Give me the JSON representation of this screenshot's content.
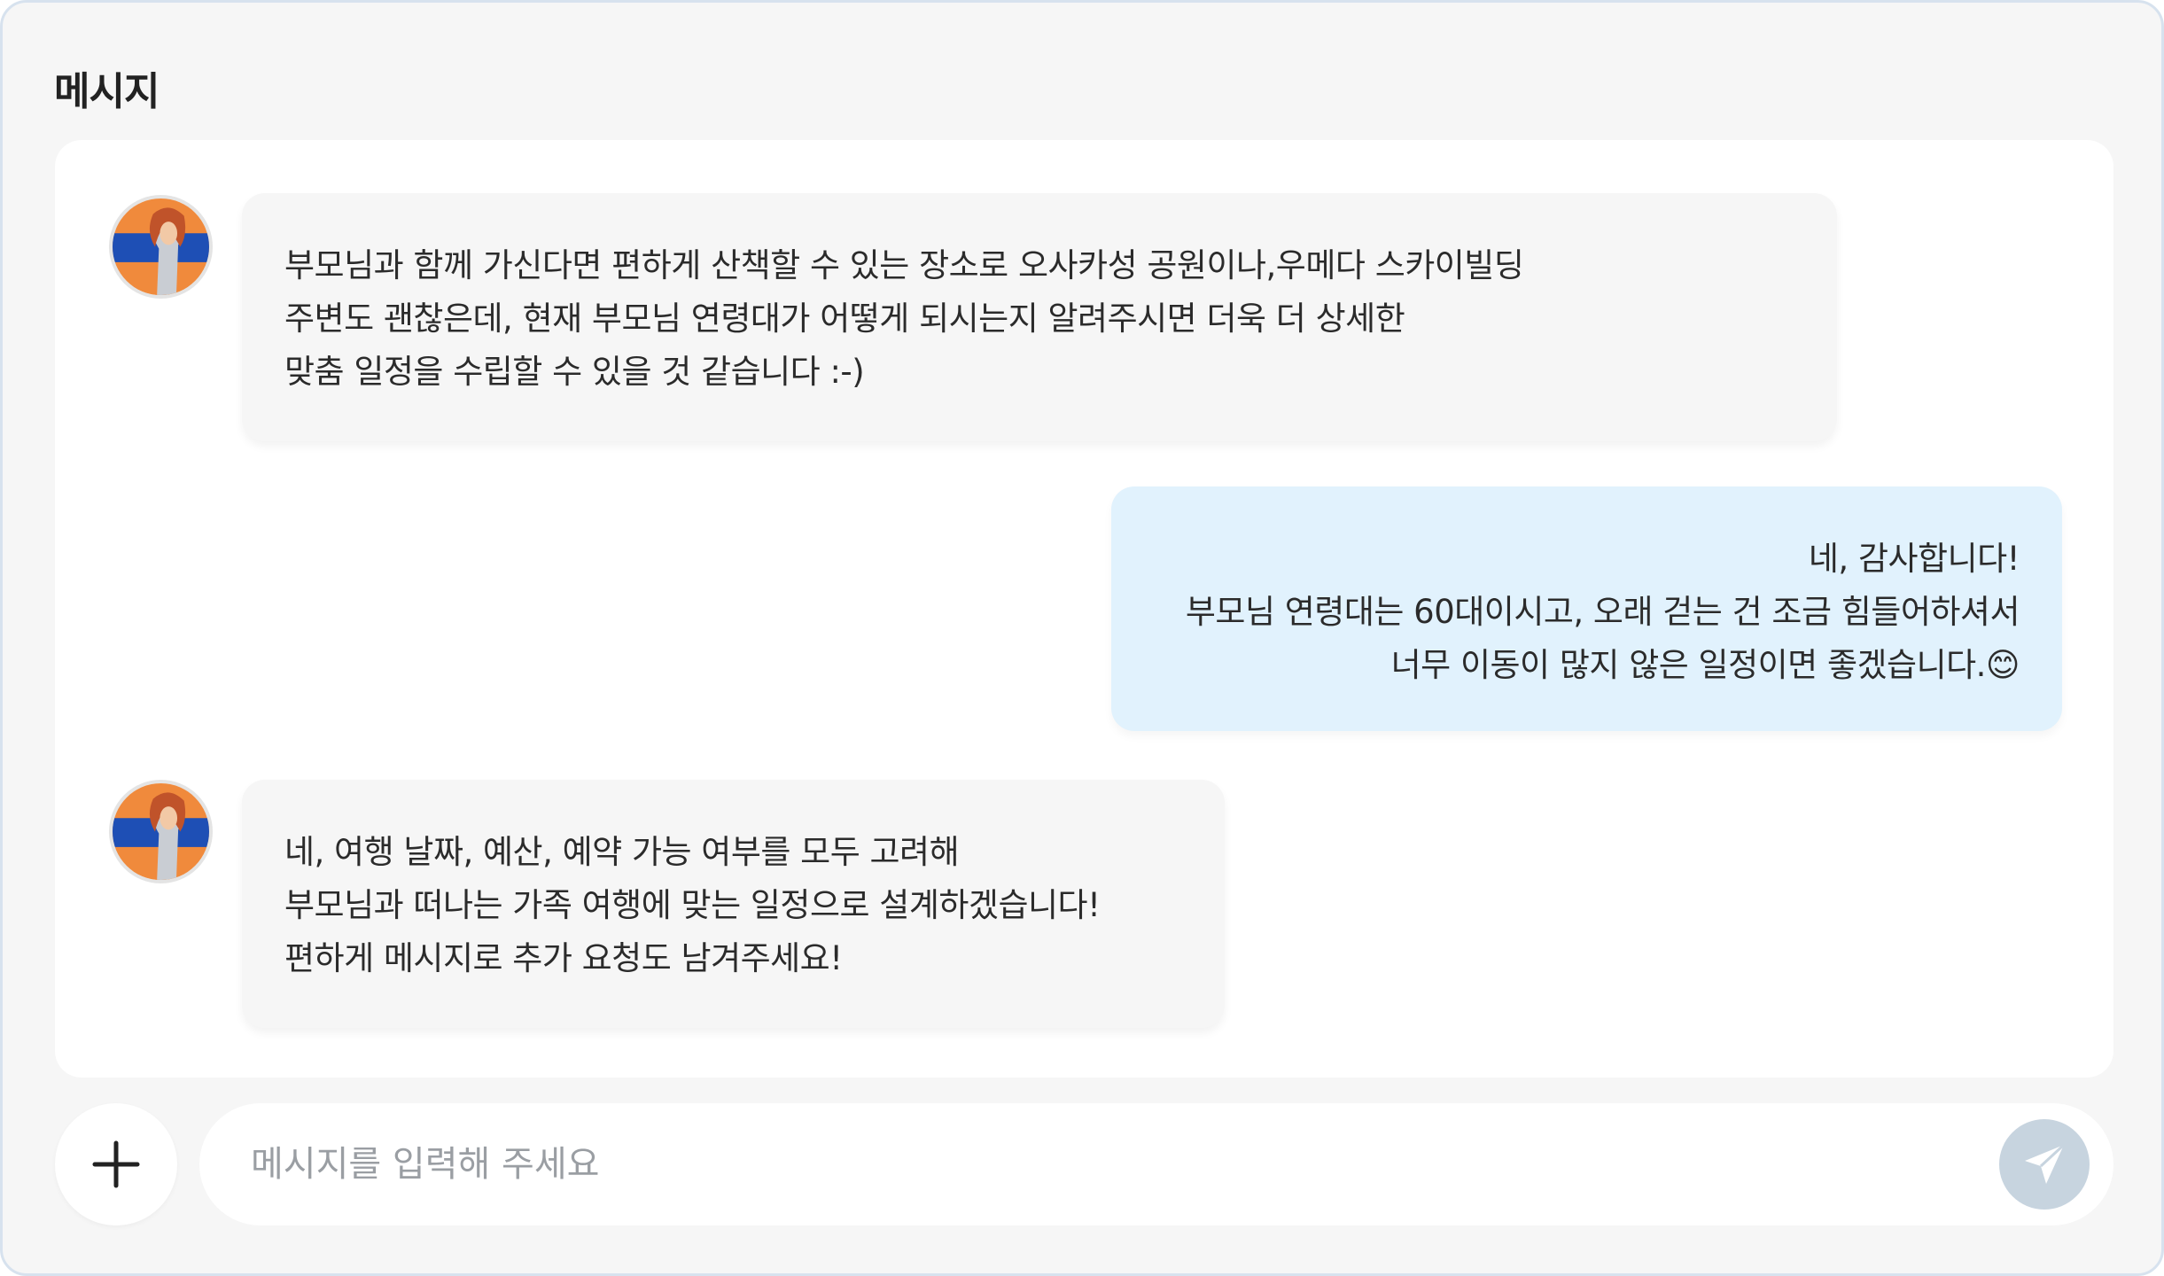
{
  "header": {
    "title": "메시지"
  },
  "messages": [
    {
      "from": "agent",
      "text": "부모님과 함께 가신다면 편하게 산책할 수 있는 장소로 오사카성 공원이나,우메다 스카이빌딩\n주변도 괜찮은데, 현재 부모님 연령대가 어떻게 되시는지 알려주시면 더욱 더 상세한\n맞춤 일정을 수립할 수 있을 것 같습니다 :-)"
    },
    {
      "from": "user",
      "text": "네, 감사합니다!\n부모님 연령대는 60대이시고, 오래 걷는 건 조금 힘들어하셔서\n너무 이동이 많지 않은 일정이면 좋겠습니다.😊"
    },
    {
      "from": "agent",
      "text": "네, 여행 날짜, 예산, 예약 가능 여부를 모두 고려해\n부모님과 떠나는 가족 여행에 맞는 일정으로 설계하겠습니다!\n편하게 메시지로 추가 요청도 남겨주세요!"
    }
  ],
  "composer": {
    "placeholder": "메시지를 입력해 주세요",
    "value": ""
  },
  "icons": {
    "add": "plus-icon",
    "send": "send-icon",
    "avatar": "agent-avatar"
  },
  "colors": {
    "background": "#f6f6f6",
    "agent_bubble": "#f6f6f6",
    "user_bubble": "#e1f2fd",
    "send_button": "#c7d4df",
    "frame_border": "#d7e2ee"
  }
}
